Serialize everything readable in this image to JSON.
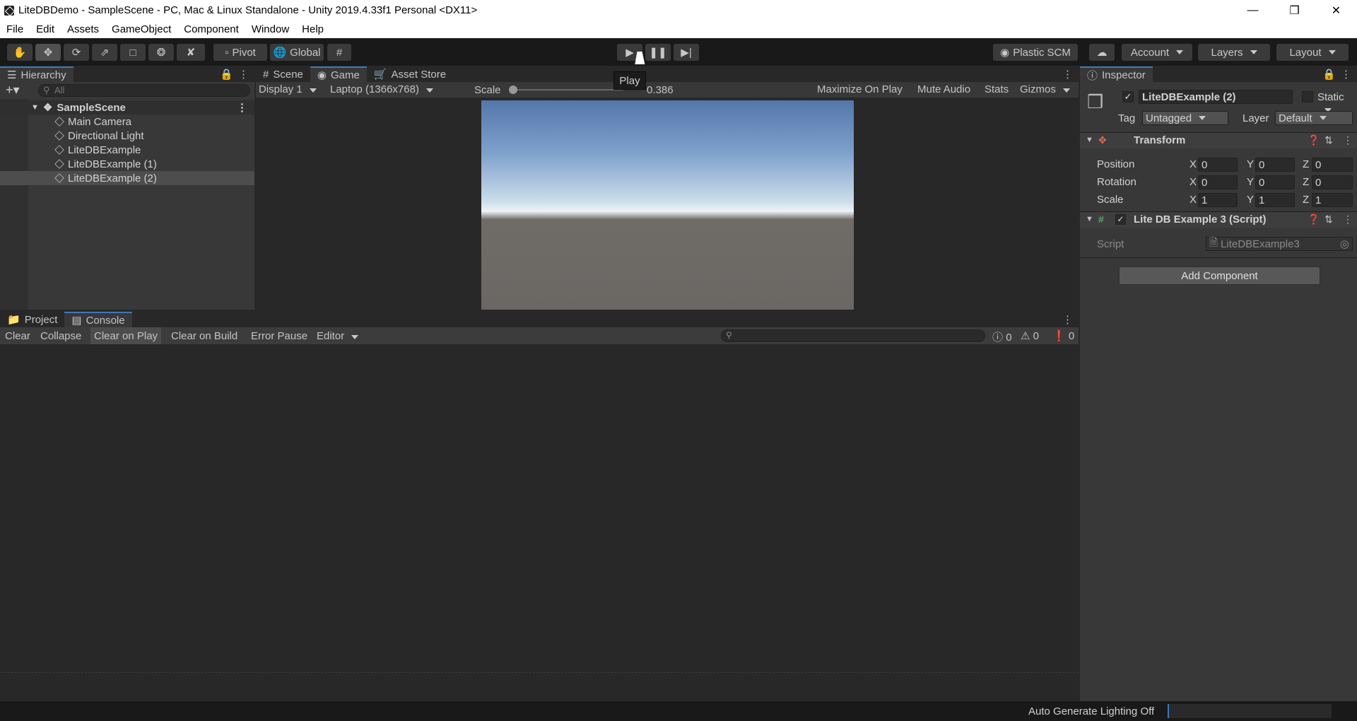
{
  "window": {
    "title": "LiteDBDemo - SampleScene - PC, Mac & Linux Standalone - Unity 2019.4.33f1 Personal <DX11>"
  },
  "menu": [
    "File",
    "Edit",
    "Assets",
    "GameObject",
    "Component",
    "Window",
    "Help"
  ],
  "toolbar": {
    "pivot": "Pivot",
    "global": "Global",
    "plastic": "Plastic SCM",
    "account": "Account",
    "layers": "Layers",
    "layout": "Layout",
    "play_tooltip": "Play"
  },
  "hierarchy": {
    "tab": "Hierarchy",
    "search_placeholder": "All",
    "scene": "SampleScene",
    "items": [
      "Main Camera",
      "Directional Light",
      "LiteDBExample",
      "LiteDBExample (1)",
      "LiteDBExample (2)"
    ]
  },
  "center_tabs": [
    "Scene",
    "Game",
    "Asset Store"
  ],
  "game": {
    "display": "Display 1",
    "resolution": "Laptop (1366x768)",
    "scale_label": "Scale",
    "scale_value": "0.386",
    "maximize": "Maximize On Play",
    "mute": "Mute Audio",
    "stats": "Stats",
    "gizmos": "Gizmos"
  },
  "bottom_tabs": [
    "Project",
    "Console"
  ],
  "console": {
    "clear": "Clear",
    "collapse": "Collapse",
    "clear_on_play": "Clear on Play",
    "clear_on_build": "Clear on Build",
    "error_pause": "Error Pause",
    "editor": "Editor",
    "info_count": "0",
    "warn_count": "0",
    "error_count": "0"
  },
  "inspector": {
    "tab": "Inspector",
    "object_name": "LiteDBExample (2)",
    "static": "Static",
    "tag_label": "Tag",
    "tag_value": "Untagged",
    "layer_label": "Layer",
    "layer_value": "Default",
    "transform": {
      "title": "Transform",
      "rows": [
        {
          "label": "Position",
          "x": "0",
          "y": "0",
          "z": "0"
        },
        {
          "label": "Rotation",
          "x": "0",
          "y": "0",
          "z": "0"
        },
        {
          "label": "Scale",
          "x": "1",
          "y": "1",
          "z": "1"
        }
      ]
    },
    "script_component": {
      "title": "Lite DB Example 3 (Script)",
      "script_label": "Script",
      "script_value": "LiteDBExample3"
    },
    "add_component": "Add Component"
  },
  "status": {
    "text": "Auto Generate Lighting Off"
  },
  "axis_labels": {
    "x": "X",
    "y": "Y",
    "z": "Z"
  }
}
